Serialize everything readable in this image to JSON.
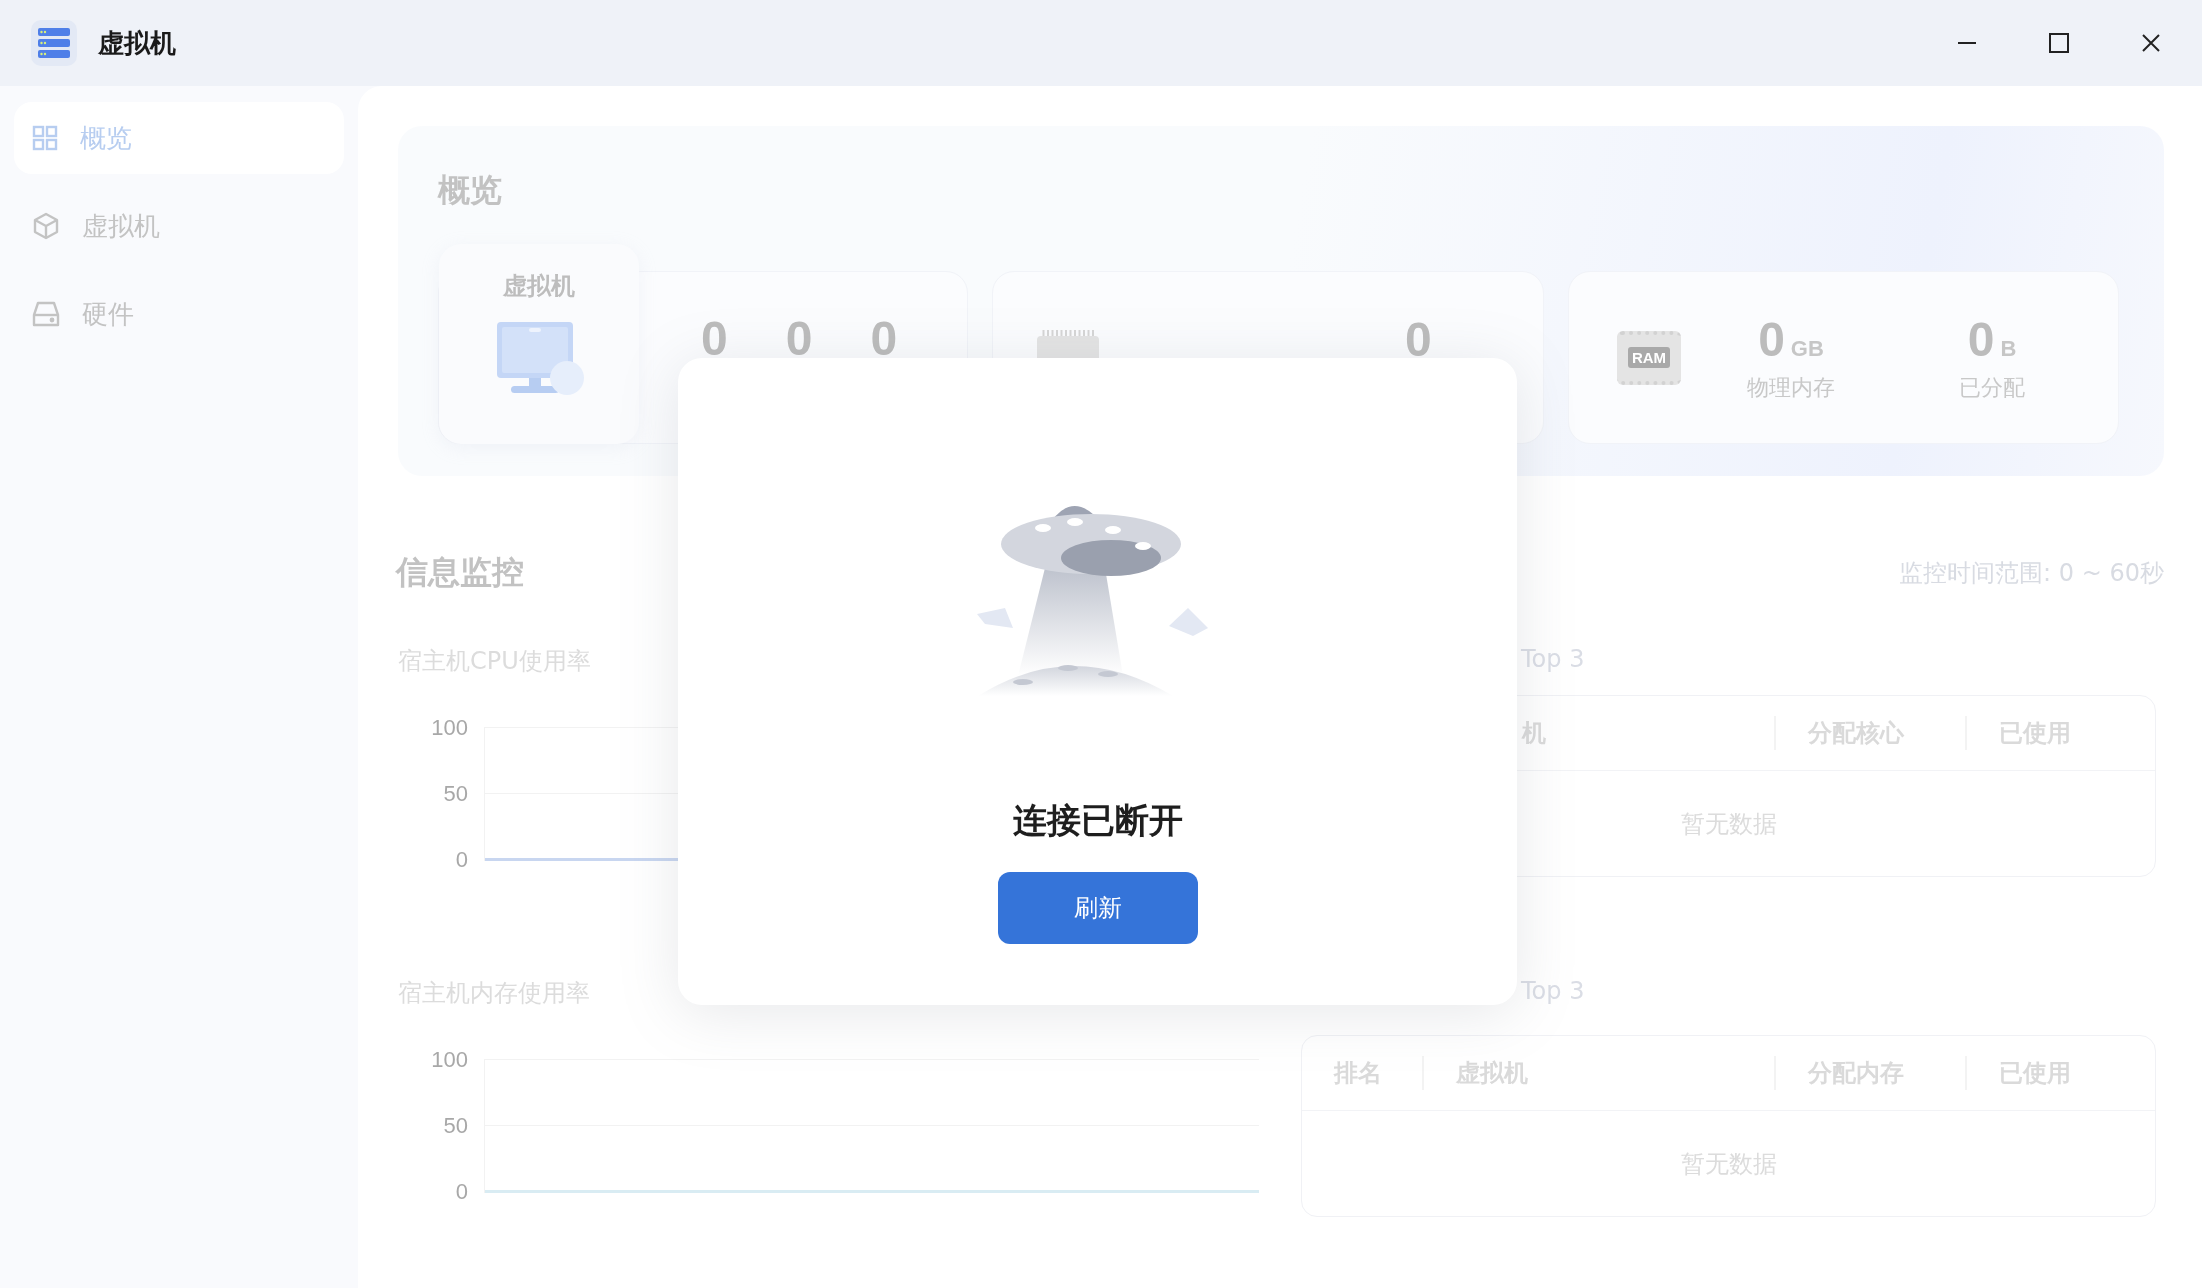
{
  "window": {
    "title": "虚拟机"
  },
  "sidebar": {
    "items": [
      {
        "label": "概览",
        "kind": "grid",
        "selected": true
      },
      {
        "label": "虚拟机",
        "kind": "cube",
        "selected": false
      },
      {
        "label": "硬件",
        "kind": "drive",
        "selected": false
      }
    ]
  },
  "overview": {
    "title": "概览",
    "vm_card": {
      "label": "虚拟机",
      "counts": [
        "0",
        "0",
        "0"
      ]
    },
    "cpu_card": {
      "value": "0"
    },
    "memory_card": {
      "chip_label": "RAM",
      "stats": [
        {
          "value": "0",
          "unit": "GB",
          "label": "物理内存"
        },
        {
          "value": "0",
          "unit": "B",
          "label": "已分配"
        }
      ]
    }
  },
  "monitor": {
    "title": "信息监控",
    "range": "监控时间范围: 0 ~ 60秒",
    "charts": [
      {
        "title": "宿主机CPU使用率",
        "yticks": [
          "100",
          "50",
          "0"
        ]
      },
      {
        "title": "宿主机内存使用率",
        "yticks": [
          "100",
          "50",
          "0"
        ]
      }
    ],
    "tables": [
      {
        "title": "Top 3",
        "columns": [
          "机",
          "分配核心",
          "已使用"
        ],
        "empty_text": "暂无数据"
      },
      {
        "title": "Top 3",
        "columns": [
          "排名",
          "虚拟机",
          "分配内存",
          "已使用"
        ],
        "empty_text": "暂无数据"
      }
    ]
  },
  "dialog": {
    "message": "连接已断开",
    "button": "刷新"
  }
}
